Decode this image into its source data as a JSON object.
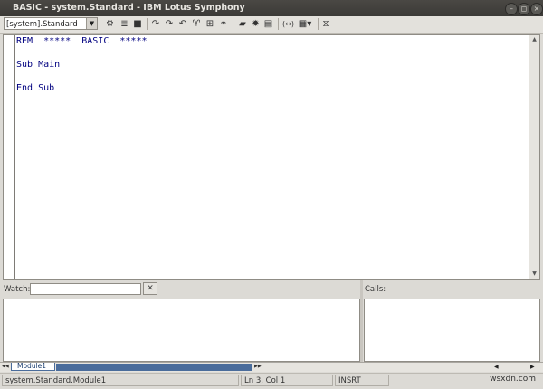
{
  "window": {
    "title": "BASIC - system.Standard - IBM Lotus Symphony",
    "controls": [
      "minimize",
      "maximize",
      "close"
    ]
  },
  "toolbar": {
    "library_select": "[system].Standard",
    "icons": [
      "compile-icon",
      "run-icon",
      "stop-icon",
      "step-into-icon",
      "step-over-icon",
      "step-out-icon",
      "breakpoint-icon",
      "manage-breakpoints-icon",
      "macros-icon",
      "modules-icon",
      "find-parentheses-icon",
      "insert-source-icon",
      "save-source-icon",
      "import-dialog-icon"
    ]
  },
  "editor": {
    "lines": [
      "REM  *****  BASIC  *****",
      "",
      "Sub Main",
      "",
      "End Sub"
    ]
  },
  "watch": {
    "label": "Watch:",
    "input_value": ""
  },
  "calls": {
    "label": "Calls:"
  },
  "tabs": {
    "active": "Module1"
  },
  "status": {
    "module": "system.Standard.Module1",
    "position": "Ln 3, Col 1",
    "mode": "INSRT"
  },
  "watermark": "wsxdn.com",
  "colors": {
    "code_text": "#000080",
    "tab_accent": "#4a6c9b",
    "titlebar": "#3b3a37"
  }
}
